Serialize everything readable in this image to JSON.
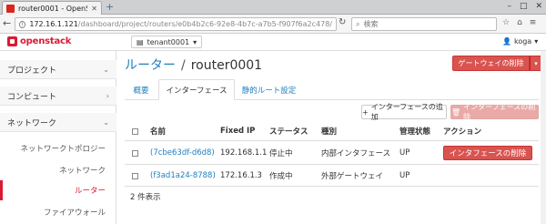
{
  "browser": {
    "tab_title": "router0001 - OpenSt...",
    "url_host": "172.16.1.121",
    "url_path": "/dashboard/project/routers/e0b4b2c6-92e8-4b7c-a7b5-f907f6a2c478/",
    "search_placeholder": "検索",
    "win_min": "–",
    "win_max": "□",
    "win_close": "✕"
  },
  "header": {
    "logo_text": "openstack",
    "project": "tenant0001",
    "user": "koga"
  },
  "sidebar": {
    "sections": [
      {
        "label": "プロジェクト"
      },
      {
        "label": "コンピュート"
      },
      {
        "label": "ネットワーク"
      }
    ],
    "items": [
      {
        "label": "ネットワークトポロジー"
      },
      {
        "label": "ネットワーク"
      },
      {
        "label": "ルーター"
      },
      {
        "label": "ファイアウォール"
      }
    ]
  },
  "page": {
    "breadcrumb_root": "ルーター",
    "separator": "/",
    "router_name": "router0001",
    "gateway_delete": "ゲートウェイの削除"
  },
  "tabs": [
    {
      "label": "概要"
    },
    {
      "label": "インターフェース"
    },
    {
      "label": "静的ルート設定"
    }
  ],
  "toolbar": {
    "add_interface": "インターフェースの追加",
    "delete_interfaces": "インターフェースの削除"
  },
  "table": {
    "columns": [
      "名前",
      "Fixed IP",
      "ステータス",
      "種別",
      "管理状態",
      "アクション"
    ],
    "rows": [
      {
        "name": "(7cbe63df-d6d8)",
        "ip": "192.168.1.1",
        "status": "停止中",
        "type": "内部インタフェース",
        "admin": "UP",
        "action": "インタフェースの削除"
      },
      {
        "name": "(f3ad1a24-8788)",
        "ip": "172.16.1.3",
        "status": "作成中",
        "type": "外部ゲートウェイ",
        "admin": "UP",
        "action": ""
      }
    ],
    "footer": "2 件表示"
  },
  "colors": {
    "brand_red": "#da1a32",
    "link_blue": "#1f7fbf",
    "danger": "#d9534f"
  }
}
